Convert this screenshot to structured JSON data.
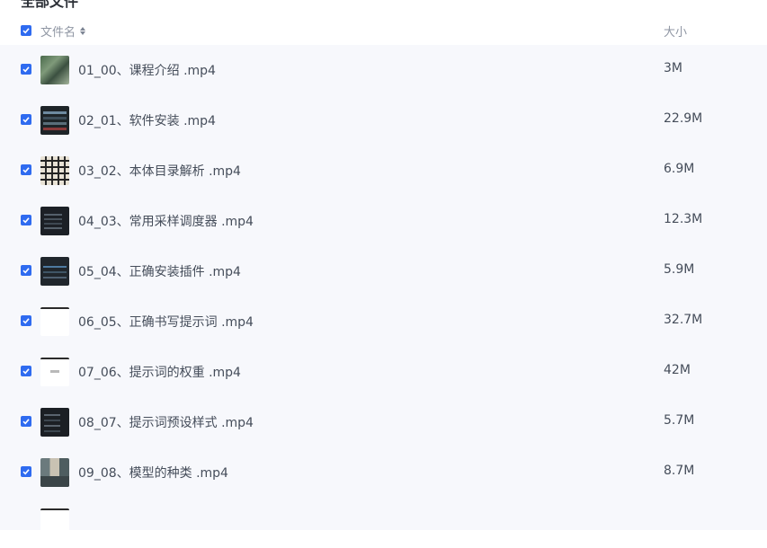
{
  "page": {
    "section_title": "全部文件"
  },
  "header": {
    "name_label": "文件名",
    "size_label": "大小",
    "select_all_checked": true
  },
  "accent_color": "#2f6bf0",
  "files": [
    {
      "name": "01_00、课程介绍 .mp4",
      "size": "3M",
      "checked": true,
      "thumb": "video-thumbnail"
    },
    {
      "name": "02_01、软件安装 .mp4",
      "size": "22.9M",
      "checked": true,
      "thumb": "video-thumbnail"
    },
    {
      "name": "03_02、本体目录解析 .mp4",
      "size": "6.9M",
      "checked": true,
      "thumb": "video-thumbnail"
    },
    {
      "name": "04_03、常用采样调度器 .mp4",
      "size": "12.3M",
      "checked": true,
      "thumb": "video-thumbnail"
    },
    {
      "name": "05_04、正确安装插件 .mp4",
      "size": "5.9M",
      "checked": true,
      "thumb": "video-thumbnail"
    },
    {
      "name": "06_05、正确书写提示词 .mp4",
      "size": "32.7M",
      "checked": true,
      "thumb": "video-thumbnail"
    },
    {
      "name": "07_06、提示词的权重 .mp4",
      "size": "42M",
      "checked": true,
      "thumb": "video-thumbnail"
    },
    {
      "name": "08_07、提示词预设样式 .mp4",
      "size": "5.7M",
      "checked": true,
      "thumb": "video-thumbnail"
    },
    {
      "name": "09_08、模型的种类 .mp4",
      "size": "8.7M",
      "checked": true,
      "thumb": "video-thumbnail"
    }
  ]
}
